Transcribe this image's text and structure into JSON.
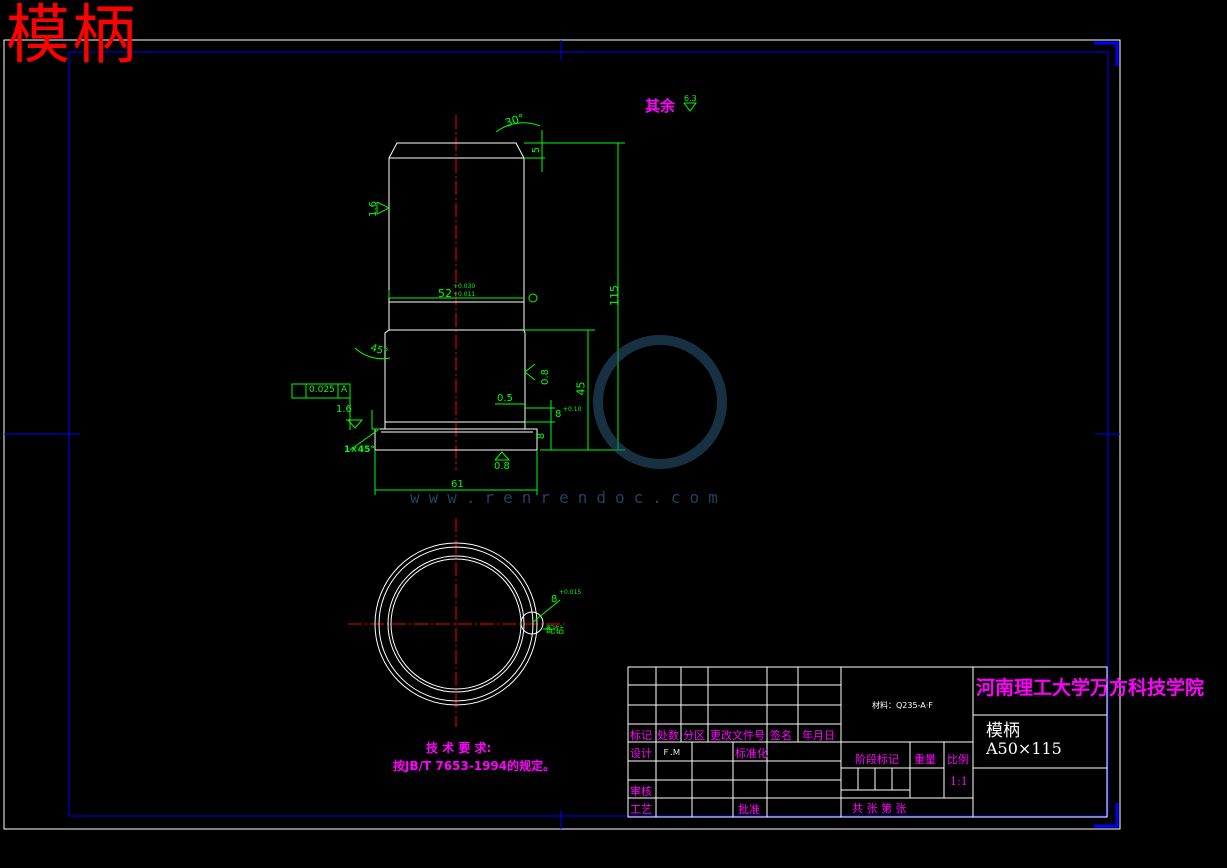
{
  "title": "模柄",
  "roughness_note": {
    "label": "其余",
    "value": "6.3"
  },
  "dimensions": {
    "chamfer_top": "30°",
    "top_height": "5",
    "roughness_side": "1.6",
    "diameter": "52",
    "diameter_tol_upper": "+0.030",
    "diameter_tol_lower": "+0.011",
    "total_height": "115",
    "chamfer_mid": "45°",
    "roughness_mid": "0.8",
    "lower_height": "45",
    "step": "0.5",
    "slot": "8",
    "slot_tol": "+0.10",
    "base_height": "8",
    "geo_tol": "0.025",
    "datum": "A",
    "roughness_left": "1.6",
    "chamfer_base": "1×45°",
    "roughness_bottom": "0.8",
    "base_width": "61",
    "keyway": "8",
    "keyway_tol": "+0.015",
    "keyway_label": "配钻"
  },
  "tech_req": {
    "heading": "技 术 要 求:",
    "line1": "按JB/T 7653-1994的规定。"
  },
  "title_block": {
    "school": "河南理工大学万方科技学院",
    "part_name": "模柄",
    "part_code": "A50×115",
    "material": "材料：Q235-A·F",
    "labels": {
      "mark": "标记",
      "count": "处数",
      "zone": "分区",
      "change_doc": "更改文件号",
      "sign": "签名",
      "date": "年月日",
      "design": "设计",
      "designer": "Ｆ.Ｍ",
      "standard": "标准化",
      "stage": "阶段标记",
      "weight": "重量",
      "scale": "比例",
      "scale_value": "1:1",
      "review": "审核",
      "process": "工艺",
      "approve": "批准",
      "sheets": "共    张 第    张"
    }
  },
  "watermark": {
    "text": "www.renrendoc.com"
  },
  "colors": {
    "border": "#0000ff",
    "outline": "#ffffff",
    "dim": "#00ff00",
    "center": "#ff0000",
    "note": "#ff00ff",
    "block": "#ffffff"
  }
}
